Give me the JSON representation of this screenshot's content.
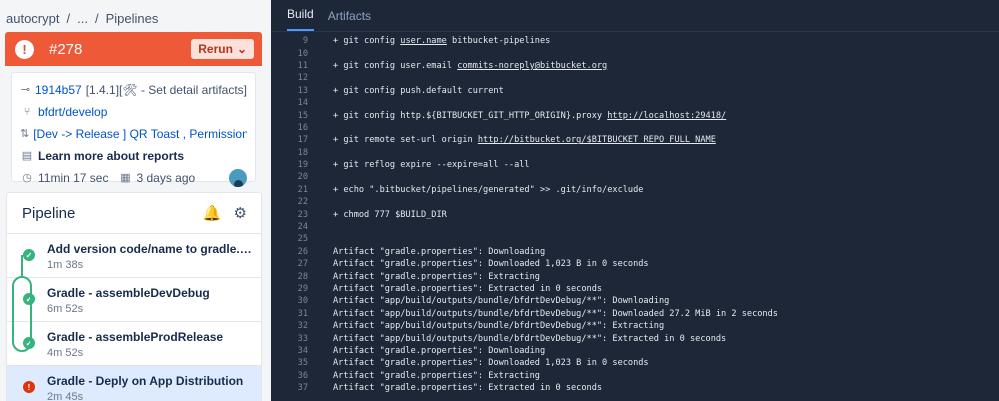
{
  "breadcrumb": {
    "repo": "autocrypt",
    "ellipsis": "...",
    "current": "Pipelines",
    "sep": "/"
  },
  "build": {
    "number": "#278",
    "status_icon": "error-icon",
    "rerun_label": "Rerun",
    "header_color": "#ee5a38"
  },
  "info": {
    "commit_hash": "1914b57",
    "commit_message": "[1.4.1][🛠 - Set detail artifacts]",
    "branch": "bfdrt/develop",
    "pr_title": "[Dev -> Release ] QR Toast , Permission Logic",
    "reports_link": "Learn more about reports",
    "duration": "11min 17 sec",
    "started": "3 days ago"
  },
  "pipeline": {
    "title": "Pipeline",
    "steps": [
      {
        "title": "Add version code/name to gradle.properties for ...",
        "time": "1m 38s",
        "status": "ok"
      },
      {
        "title": "Gradle - assembleDevDebug",
        "time": "6m 52s",
        "status": "ok"
      },
      {
        "title": "Gradle - assembleProdRelease",
        "time": "4m 52s",
        "status": "ok"
      },
      {
        "title": "Gradle - Deply on App Distribution",
        "time": "2m 45s",
        "status": "fail"
      }
    ]
  },
  "tabs": {
    "build": "Build",
    "artifacts": "Artifacts"
  },
  "log": [
    {
      "n": "9",
      "t": "+ git config ",
      "u": "user.name",
      "r": " bitbucket-pipelines"
    },
    {
      "n": "10",
      "t": ""
    },
    {
      "n": "11",
      "t": "+ git config user.email ",
      "u": "commits-noreply@bitbucket.org",
      "r": ""
    },
    {
      "n": "12",
      "t": ""
    },
    {
      "n": "13",
      "t": "+ git config push.default current"
    },
    {
      "n": "14",
      "t": ""
    },
    {
      "n": "15",
      "t": "+ git config http.${BITBUCKET_GIT_HTTP_ORIGIN}.proxy ",
      "u": "http://localhost:29418/",
      "r": ""
    },
    {
      "n": "16",
      "t": ""
    },
    {
      "n": "17",
      "t": "+ git remote set-url origin ",
      "u": "http://bitbucket.org/$BITBUCKET_REPO_FULL_NAME",
      "r": ""
    },
    {
      "n": "18",
      "t": ""
    },
    {
      "n": "19",
      "t": "+ git reflog expire --expire=all --all"
    },
    {
      "n": "20",
      "t": ""
    },
    {
      "n": "21",
      "t": "+ echo \".bitbucket/pipelines/generated\" >> .git/info/exclude"
    },
    {
      "n": "22",
      "t": ""
    },
    {
      "n": "23",
      "t": "+ chmod 777 $BUILD_DIR"
    },
    {
      "n": "24",
      "t": ""
    },
    {
      "n": "25",
      "t": ""
    },
    {
      "n": "26",
      "t": "Artifact \"gradle.properties\": Downloading"
    },
    {
      "n": "27",
      "t": "Artifact \"gradle.properties\": Downloaded 1,023 B in 0 seconds"
    },
    {
      "n": "28",
      "t": "Artifact \"gradle.properties\": Extracting"
    },
    {
      "n": "29",
      "t": "Artifact \"gradle.properties\": Extracted in 0 seconds"
    },
    {
      "n": "30",
      "t": "Artifact \"app/build/outputs/bundle/bfdrtDevDebug/**\": Downloading"
    },
    {
      "n": "31",
      "t": "Artifact \"app/build/outputs/bundle/bfdrtDevDebug/**\": Downloaded 27.2 MiB in 2 seconds"
    },
    {
      "n": "32",
      "t": "Artifact \"app/build/outputs/bundle/bfdrtDevDebug/**\": Extracting"
    },
    {
      "n": "33",
      "t": "Artifact \"app/build/outputs/bundle/bfdrtDevDebug/**\": Extracted in 0 seconds"
    },
    {
      "n": "34",
      "t": "Artifact \"gradle.properties\": Downloading"
    },
    {
      "n": "35",
      "t": "Artifact \"gradle.properties\": Downloaded 1,023 B in 0 seconds"
    },
    {
      "n": "36",
      "t": "Artifact \"gradle.properties\": Extracting"
    },
    {
      "n": "37",
      "t": "Artifact \"gradle.properties\": Extracted in 0 seconds"
    }
  ]
}
